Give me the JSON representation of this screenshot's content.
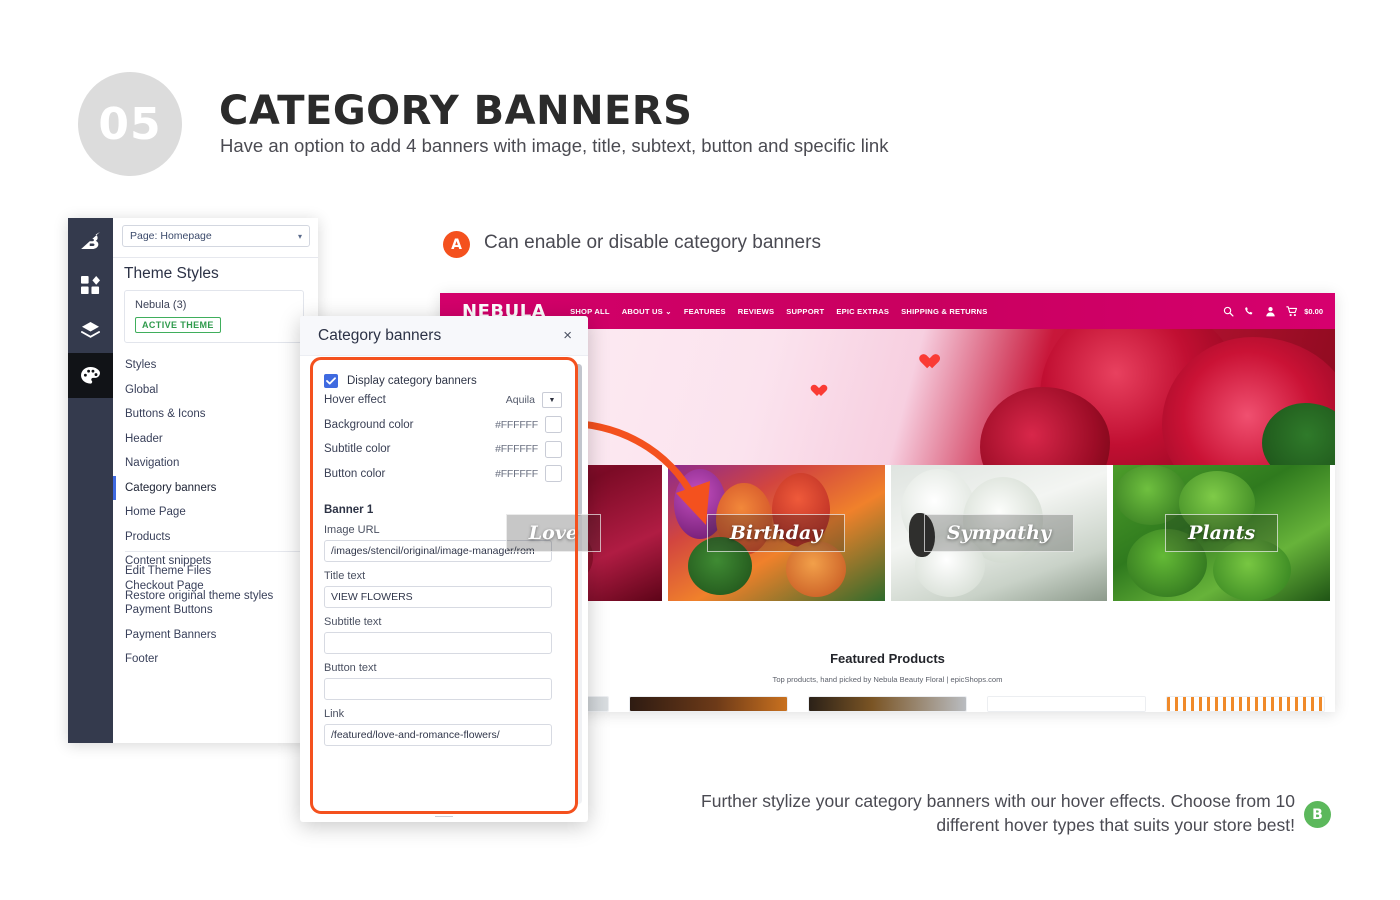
{
  "header": {
    "number": "05",
    "title": "CATEGORY BANNERS",
    "subtitle": "Have an option to add 4 banners with image, title, subtext, button and specific link"
  },
  "admin": {
    "rail_icons": [
      "bigcommerce-logo-icon",
      "apps-grid-icon",
      "layers-icon",
      "palette-icon"
    ],
    "page_select": {
      "value": "Page: Homepage",
      "caret": "▾"
    },
    "panel_title": "Theme Styles",
    "theme_card": {
      "name": "Nebula (3)",
      "badge": "ACTIVE THEME"
    },
    "menu_items": [
      {
        "label": "Styles",
        "selected": false
      },
      {
        "label": "Global",
        "selected": false
      },
      {
        "label": "Buttons & Icons",
        "selected": false
      },
      {
        "label": "Header",
        "selected": false
      },
      {
        "label": "Navigation",
        "selected": false
      },
      {
        "label": "Category banners",
        "selected": true
      },
      {
        "label": "Home Page",
        "selected": false
      },
      {
        "label": "Products",
        "selected": false
      },
      {
        "label": "Content snippets",
        "selected": false
      },
      {
        "label": "Checkout Page",
        "selected": false
      },
      {
        "label": "Payment Buttons",
        "selected": false
      },
      {
        "label": "Payment Banners",
        "selected": false
      },
      {
        "label": "Footer",
        "selected": false
      }
    ],
    "links": [
      "Edit Theme Files",
      "Restore original theme styles"
    ]
  },
  "dialog": {
    "title": "Category banners",
    "close_label": "×",
    "display_checkbox_label": "Display category banners",
    "display_checked": true,
    "settings": [
      {
        "label": "Hover effect",
        "value": "Aquila",
        "control": "select"
      },
      {
        "label": "Background color",
        "value": "#FFFFFF",
        "control": "swatch"
      },
      {
        "label": "Subtitle color",
        "value": "#FFFFFF",
        "control": "swatch"
      },
      {
        "label": "Button color",
        "value": "#FFFFFF",
        "control": "swatch"
      }
    ],
    "banner_section_title": "Banner 1",
    "fields": [
      {
        "label": "Image URL",
        "value": "/images/stencil/original/image-manager/rom"
      },
      {
        "label": "Title text",
        "value": "VIEW FLOWERS"
      },
      {
        "label": "Subtitle text",
        "value": ""
      },
      {
        "label": "Button text",
        "value": ""
      },
      {
        "label": "Link",
        "value": "/featured/love-and-romance-flowers/"
      }
    ],
    "highlight_color": "#F4511E"
  },
  "store": {
    "logo": "NEBULA",
    "nav": [
      "SHOP ALL",
      "ABOUT US ⌄",
      "FEATURES",
      "REVIEWS",
      "SUPPORT",
      "EPIC EXTRAS",
      "SHIPPING & RETURNS"
    ],
    "header_icons": [
      "search-icon",
      "phone-icon",
      "user-icon",
      "cart-icon"
    ],
    "cart_total": "$0.00",
    "header_color": "#D5006D",
    "category_banners": [
      {
        "label": "Love",
        "theme": "roses"
      },
      {
        "label": "Birthday",
        "theme": "tulips"
      },
      {
        "label": "Sympathy",
        "theme": "lilies"
      },
      {
        "label": "Plants",
        "theme": "plants"
      }
    ],
    "featured": {
      "title": "Featured Products",
      "subtitle": "Top products, hand picked by Nebula Beauty Floral | epicShops.com"
    }
  },
  "annotations": {
    "a": {
      "badge": "A",
      "text": "Can enable or disable category banners",
      "color": "#F4511E"
    },
    "b": {
      "badge": "B",
      "text": "Further stylize your category banners with our hover effects. Choose from 10 different hover types that suits your store best!",
      "color": "#5CB85C"
    }
  }
}
